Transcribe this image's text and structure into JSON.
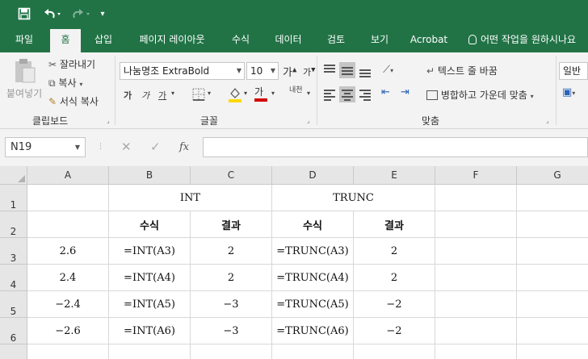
{
  "quick_access": {
    "save": "save-icon",
    "undo": "undo-icon",
    "redo": "redo-icon",
    "customize": "▾"
  },
  "tabs": [
    {
      "label": "파일",
      "active": false
    },
    {
      "label": "홈",
      "active": true
    },
    {
      "label": "삽입",
      "active": false
    },
    {
      "label": "페이지 레이아웃",
      "active": false
    },
    {
      "label": "수식",
      "active": false
    },
    {
      "label": "데이터",
      "active": false
    },
    {
      "label": "검토",
      "active": false
    },
    {
      "label": "보기",
      "active": false
    },
    {
      "label": "Acrobat",
      "active": false
    }
  ],
  "tell_me": "어떤 작업을 원하시나요",
  "ribbon": {
    "clipboard": {
      "paste": "붙여넣기",
      "cut": "잘라내기",
      "copy": "복사",
      "format_painter": "서식 복사",
      "group_label": "클립보드"
    },
    "font": {
      "font_name": "나눔명조 ExtraBold",
      "font_size": "10",
      "grow": "가",
      "shrink": "가",
      "bold": "가",
      "italic": "가",
      "underline": "가",
      "phonetic": "내천",
      "group_label": "글꼴"
    },
    "alignment": {
      "wrap_text": "텍스트 줄 바꿈",
      "merge_center": "병합하고 가운데 맞춤",
      "group_label": "맞춤"
    },
    "number": {
      "format": "일반"
    }
  },
  "formula_bar": {
    "name_box": "N19",
    "cancel": "✕",
    "enter": "✓",
    "fx": "fx",
    "value": ""
  },
  "columns": [
    "A",
    "B",
    "C",
    "D",
    "E",
    "F",
    "G"
  ],
  "rows": [
    "1",
    "2",
    "3",
    "4",
    "5",
    "6"
  ],
  "sheet": {
    "r1": {
      "int_header": "INT",
      "trunc_header": "TRUNC"
    },
    "r2": {
      "b": "수식",
      "c": "결과",
      "d": "수식",
      "e": "결과"
    },
    "r3": {
      "a": "2.6",
      "b": "=INT(A3)",
      "c": "2",
      "d": "=TRUNC(A3)",
      "e": "2"
    },
    "r4": {
      "a": "2.4",
      "b": "=INT(A4)",
      "c": "2",
      "d": "=TRUNC(A4)",
      "e": "2"
    },
    "r5": {
      "a": "−2.4",
      "b": "=INT(A5)",
      "c": "−3",
      "d": "=TRUNC(A5)",
      "e": "−2"
    },
    "r6": {
      "a": "−2.6",
      "b": "=INT(A6)",
      "c": "−3",
      "d": "=TRUNC(A6)",
      "e": "−2"
    }
  },
  "colors": {
    "excel_green": "#217346",
    "font_color_bar": "#d00000",
    "fill_color_bar": "#ffd800"
  }
}
